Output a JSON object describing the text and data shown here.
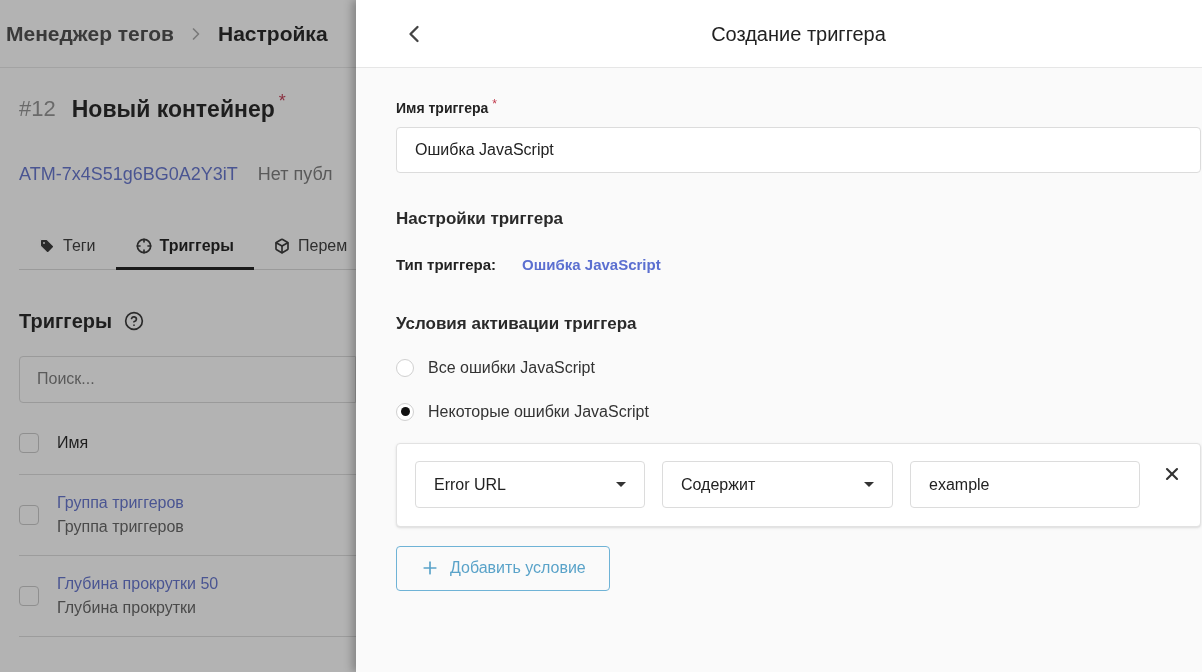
{
  "breadcrumb": [
    {
      "label": "Менеджер тегов",
      "current": false
    },
    {
      "label": "Настройка",
      "current": true
    }
  ],
  "container": {
    "number": "#12",
    "name": "Новый контейнер",
    "required_mark": "*",
    "id": "ATM-7x4S51g6BG0A2Y3iT",
    "status": "Нет публ"
  },
  "tabs": [
    {
      "label": "Теги",
      "kind": "tag",
      "selected": false
    },
    {
      "label": "Триггеры",
      "kind": "target",
      "selected": true
    },
    {
      "label": "Перем",
      "kind": "cube",
      "selected": false
    }
  ],
  "list": {
    "title": "Триггеры",
    "search": {
      "placeholder": "Поиск..."
    },
    "column": "Имя",
    "all_checked": false,
    "rows": [
      {
        "name": "Группа триггеров",
        "type": "Группа триггеров",
        "checked": false
      },
      {
        "name": "Глубина прокрутки 50",
        "type": "Глубина прокрутки",
        "checked": false
      }
    ]
  },
  "panel": {
    "title": "Создание триггера",
    "name_label": "Имя триггера",
    "name_required_mark": "*",
    "name_value": "Ошибка JavaScript",
    "settings_heading": "Настройки триггера",
    "type_label": "Тип триггера:",
    "type_value": "Ошибка JavaScript",
    "conditions_heading": "Условия активации триггера",
    "options": [
      {
        "label": "Все ошибки JavaScript",
        "selected": false
      },
      {
        "label": "Некоторые ошибки JavaScript",
        "selected": true
      }
    ],
    "conditions": [
      {
        "field": "Error URL",
        "operator": "Содержит",
        "value": "example"
      }
    ],
    "add_button": "Добавить условие"
  }
}
